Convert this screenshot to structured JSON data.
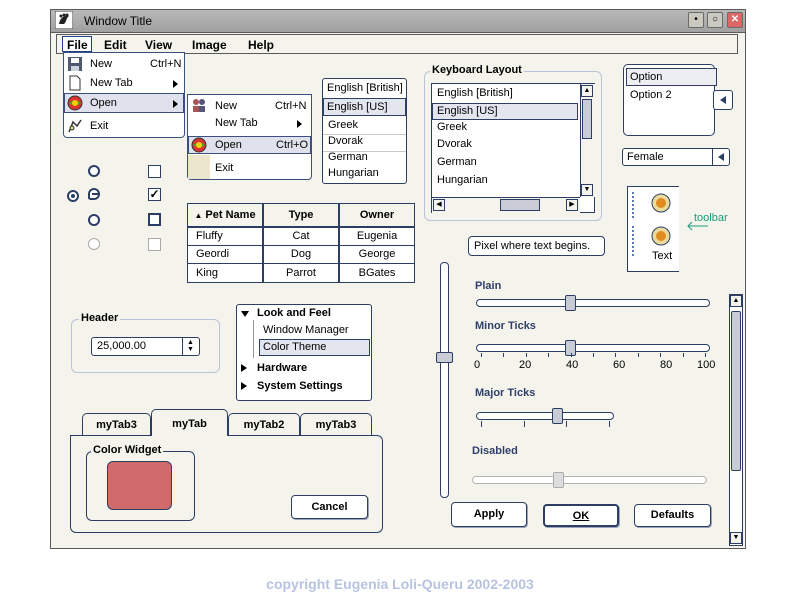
{
  "window": {
    "title": "Window Title"
  },
  "menubar": {
    "items": [
      "File",
      "Edit",
      "View",
      "Image",
      "Help"
    ]
  },
  "file_menu": {
    "items": [
      {
        "label": "New",
        "shortcut": "Ctrl+N"
      },
      {
        "label": "New Tab",
        "shortcut": ""
      },
      {
        "label": "Open",
        "shortcut": ""
      },
      {
        "label": "Exit",
        "shortcut": ""
      }
    ]
  },
  "open_submenu": {
    "items": [
      {
        "label": "New",
        "shortcut": "Ctrl+N"
      },
      {
        "label": "New Tab",
        "shortcut": ""
      },
      {
        "label": "Open",
        "shortcut": "Ctrl+O"
      },
      {
        "label": "Exit",
        "shortcut": ""
      }
    ]
  },
  "language_list": {
    "items": [
      "English [British]",
      "English [US]",
      "Greek",
      "Dvorak",
      "German",
      "Hungarian"
    ],
    "selected": "English [US]"
  },
  "keyboard_layout": {
    "title": "Keyboard Layout",
    "items": [
      "English [British]",
      "English [US]",
      "Greek",
      "Dvorak",
      "German",
      "Hungarian"
    ],
    "selected": "English [US]"
  },
  "option_list": {
    "items": [
      "Option",
      "Option 2"
    ],
    "selected": "Option"
  },
  "gender_select": {
    "value": "Female"
  },
  "toolbar_demo": {
    "label": "toolbar",
    "button_text": "Text"
  },
  "tooltip": {
    "text": "Pixel where text begins."
  },
  "pet_table": {
    "columns": [
      "Pet Name",
      "Type",
      "Owner"
    ],
    "rows": [
      [
        "Fluffy",
        "Cat",
        "Eugenia"
      ],
      [
        "Geordi",
        "Dog",
        "George"
      ],
      [
        "King",
        "Parrot",
        "BGates"
      ]
    ]
  },
  "header_group": {
    "title": "Header",
    "spinner_value": "25,000.00"
  },
  "tree": {
    "items": [
      "Look and Feel",
      "Window Manager",
      "Color Theme",
      "Hardware",
      "System Settings"
    ],
    "selected": "Color Theme"
  },
  "sliders": {
    "plain_label": "Plain",
    "minor_label": "Minor Ticks",
    "minor_tick_labels": [
      "0",
      "20",
      "40",
      "60",
      "80",
      "100"
    ],
    "major_label": "Major Ticks",
    "disabled_label": "Disabled",
    "plain_value": 40,
    "minor_value": 40,
    "major_value": 60,
    "disabled_value": 36,
    "vertical_value": 60
  },
  "tabs": {
    "items": [
      "myTab3",
      "myTab",
      "myTab2",
      "myTab3"
    ],
    "selected_index": 1
  },
  "color_widget": {
    "title": "Color Widget",
    "color": "#d16b6b"
  },
  "buttons": {
    "cancel": "Cancel",
    "apply": "Apply",
    "ok": "OK",
    "defaults": "Defaults"
  },
  "copyright": "copyright Eugenia Loli-Queru 2002-2003",
  "colors": {
    "accent": "#2c3e64",
    "selection": "#dfe2ec",
    "copyright": "#b7c3e0"
  }
}
